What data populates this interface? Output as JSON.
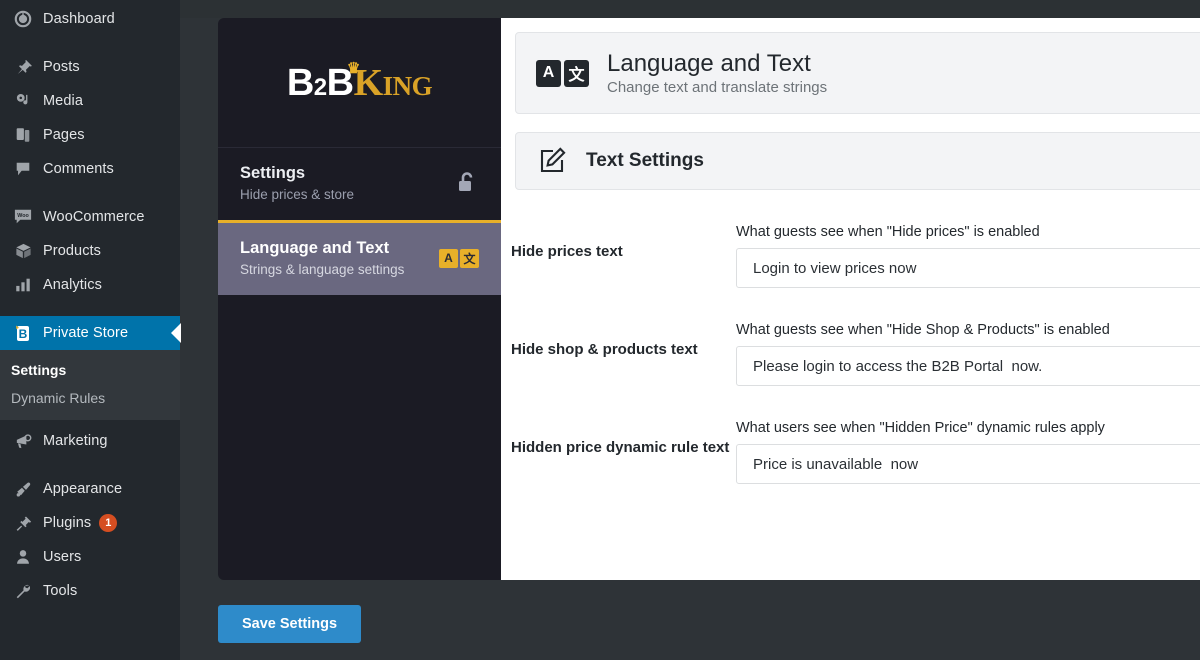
{
  "sidebar": {
    "items": [
      {
        "label": "Dashboard",
        "icon": "dashboard-icon"
      },
      {
        "label": "Posts",
        "icon": "pin-icon"
      },
      {
        "label": "Media",
        "icon": "media-icon"
      },
      {
        "label": "Pages",
        "icon": "pages-icon"
      },
      {
        "label": "Comments",
        "icon": "comment-icon"
      },
      {
        "label": "WooCommerce",
        "icon": "woo-icon"
      },
      {
        "label": "Products",
        "icon": "product-box-icon"
      },
      {
        "label": "Analytics",
        "icon": "bar-chart-icon"
      },
      {
        "label": "Private Store",
        "icon": "b2bking-icon"
      },
      {
        "label": "Marketing",
        "icon": "megaphone-icon"
      },
      {
        "label": "Appearance",
        "icon": "paintbrush-icon"
      },
      {
        "label": "Plugins",
        "icon": "plug-icon",
        "badge": "1"
      },
      {
        "label": "Users",
        "icon": "user-icon"
      },
      {
        "label": "Tools",
        "icon": "wrench-icon"
      }
    ],
    "submenu": [
      {
        "label": "Settings",
        "current": true
      },
      {
        "label": "Dynamic Rules",
        "current": false
      }
    ]
  },
  "b2b_panel": {
    "logo": {
      "b1": "B",
      "two": "2",
      "b2": "B",
      "k": "K",
      "ing": "ING"
    },
    "menu": [
      {
        "title": "Settings",
        "subtitle": "Hide prices & store",
        "icon": "unlock-icon",
        "selected": false
      },
      {
        "title": "Language and Text",
        "subtitle": "Strings & language settings",
        "icon": "translate-badge-icon",
        "badge_a": "A",
        "badge_z": "文",
        "selected": true
      }
    ]
  },
  "content": {
    "header": {
      "title": "Language and Text",
      "subtitle": "Change text and translate strings",
      "icon": "translate-badge-icon",
      "badge_a": "A",
      "badge_z": "文"
    },
    "section": {
      "title": "Text Settings",
      "icon": "edit-pencil-icon"
    },
    "fields": [
      {
        "label": "Hide prices text",
        "description": "What guests see when \"Hide prices\" is enabled",
        "value": "Login to view prices now"
      },
      {
        "label": "Hide shop & products text",
        "description": "What guests see when \"Hide Shop & Products\" is enabled",
        "value": "Please login to access the B2B Portal  now."
      },
      {
        "label": "Hidden price dynamic rule text",
        "description": "What users see when \"Hidden Price\" dynamic rules apply",
        "value": "Price is unavailable  now"
      }
    ]
  },
  "actions": {
    "save_label": "Save Settings"
  },
  "colors": {
    "sidebar_bg": "#23282d",
    "sidebar_active": "#0073aa",
    "submenu_bg": "#32373c",
    "panel_bg": "#1b1b24",
    "panel_selected": "#6a6880",
    "accent_gold": "#e8b029",
    "save_blue": "#2e8bca",
    "badge_orange": "#d54e21"
  }
}
